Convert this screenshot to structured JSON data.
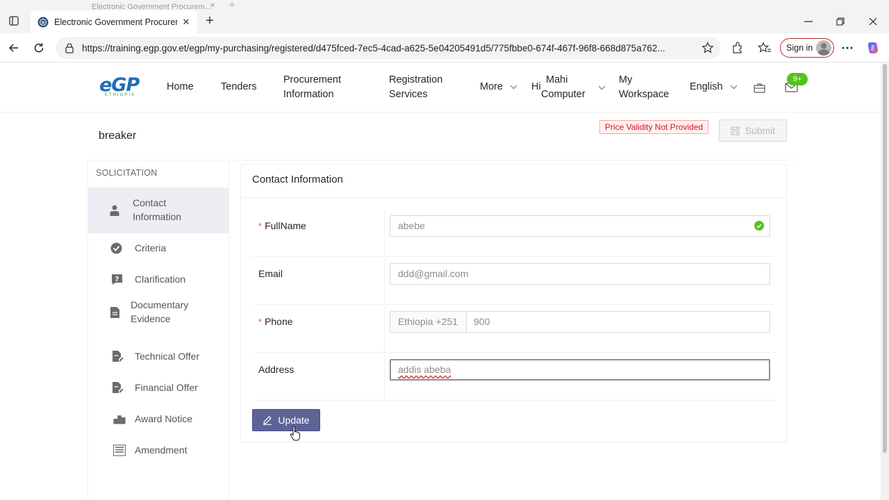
{
  "browser": {
    "ghost_tab_title": "Electronic Government Procurem...",
    "active_tab_title": "Electronic Government Procurem",
    "url": "https://training.egp.gov.et/egp/my-purchasing/registered/d475fced-7ec5-4cad-a625-5e04205491d5/775fbbe0-674f-467f-96f8-668d875a762...",
    "signin_label": "Sign in",
    "accent_color": "#c42b1c"
  },
  "header": {
    "logo_text": "eGP",
    "logo_sub": "ETHIOPIA",
    "nav": {
      "home": "Home",
      "tenders": "Tenders",
      "procurement_info_l1": "Procurement",
      "procurement_info_l2": "Information",
      "registration_l1": "Registration",
      "registration_l2": "Services",
      "more": "More",
      "greeting": "Hi",
      "user_l1": "Mahi",
      "user_l2": "Computer",
      "workspace_l1": "My",
      "workspace_l2": "Workspace",
      "language": "English"
    },
    "notification_badge": "9+"
  },
  "page": {
    "title": "breaker",
    "status_tag": "Price Validity Not Provided",
    "submit_label": "Submit"
  },
  "sidebar": {
    "heading": "SOLICITATION",
    "items": [
      {
        "label_l1": "Contact",
        "label_l2": "Information",
        "icon": "user-icon"
      },
      {
        "label": "Criteria",
        "icon": "check-circle-icon"
      },
      {
        "label": "Clarification",
        "icon": "question-icon"
      },
      {
        "label_l1": "Documentary",
        "label_l2": "Evidence",
        "icon": "file-icon"
      },
      {
        "label": "Technical Offer",
        "icon": "file-edit-icon"
      },
      {
        "label": "Financial Offer",
        "icon": "file-edit-icon"
      },
      {
        "label": "Award Notice",
        "icon": "podium-icon"
      },
      {
        "label": "Amendment",
        "icon": "list-icon"
      }
    ]
  },
  "form": {
    "card_title": "Contact Information",
    "fullname_label": "FullName",
    "fullname_value": "abebe",
    "email_label": "Email",
    "email_value": "ddd@gmail.com",
    "phone_label": "Phone",
    "phone_prefix": "Ethiopia +251",
    "phone_value": "900",
    "address_label": "Address",
    "address_value": "addis abeba",
    "update_label": "Update",
    "primary_color": "#5d6397"
  }
}
